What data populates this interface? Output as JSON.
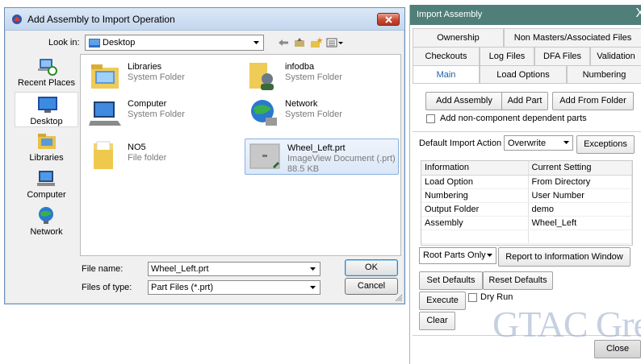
{
  "dialog": {
    "title": "Add Assembly to Import Operation",
    "look_in_label": "Look in:",
    "look_in_value": "Desktop",
    "places": [
      {
        "label": "Recent Places",
        "icon": "recent-places-icon"
      },
      {
        "label": "Desktop",
        "icon": "desktop-icon"
      },
      {
        "label": "Libraries",
        "icon": "libraries-icon"
      },
      {
        "label": "Computer",
        "icon": "computer-icon"
      },
      {
        "label": "Network",
        "icon": "network-icon"
      }
    ],
    "files": [
      {
        "name": "Libraries",
        "desc": "System Folder",
        "icon": "libraries-folder-icon"
      },
      {
        "name": "infodba",
        "desc": "System Folder",
        "icon": "user-folder-icon"
      },
      {
        "name": "Computer",
        "desc": "System Folder",
        "icon": "computer-icon"
      },
      {
        "name": "Network",
        "desc": "System Folder",
        "icon": "network-icon"
      },
      {
        "name": "NO5",
        "desc": "File folder",
        "icon": "folder-icon"
      },
      {
        "name": "Wheel_Left.prt",
        "desc": "ImageView Document (.prt)",
        "size": "88.5 KB",
        "icon": "prt-file-icon"
      }
    ],
    "file_name_label": "File name:",
    "file_name_value": "Wheel_Left.prt",
    "file_type_label": "Files of type:",
    "file_type_value": "Part Files (*.prt)",
    "ok_label": "OK",
    "cancel_label": "Cancel"
  },
  "panel": {
    "title": "Import Assembly",
    "close_glyph": "X",
    "tabs_row1": [
      "Ownership",
      "Non Masters/Associated Files"
    ],
    "tabs_row2": [
      "Checkouts",
      "Log Files",
      "DFA Files",
      "Validation"
    ],
    "tabs_row3": [
      "Main",
      "Load Options",
      "Numbering"
    ],
    "active_tab": "Main",
    "add_assembly": "Add Assembly",
    "add_part": "Add Part",
    "add_from_folder": "Add From Folder",
    "add_noncomponent": "Add non-component dependent parts",
    "default_import_label": "Default Import Action",
    "default_import_value": "Overwrite",
    "exceptions": "Exceptions",
    "grid_headers": [
      "Information",
      "Current Setting"
    ],
    "grid_rows": [
      [
        "Load Option",
        "From Directory"
      ],
      [
        "Numbering",
        "User Number"
      ],
      [
        "Output Folder",
        "demo"
      ],
      [
        "Assembly",
        "Wheel_Left"
      ]
    ],
    "root_parts_value": "Root Parts Only",
    "report_button": "Report to Information Window",
    "set_defaults": "Set Defaults",
    "reset_defaults": "Reset Defaults",
    "execute": "Execute",
    "dry_run": "Dry Run",
    "clear": "Clear",
    "close": "Close"
  },
  "watermark": "GTAC Gre"
}
